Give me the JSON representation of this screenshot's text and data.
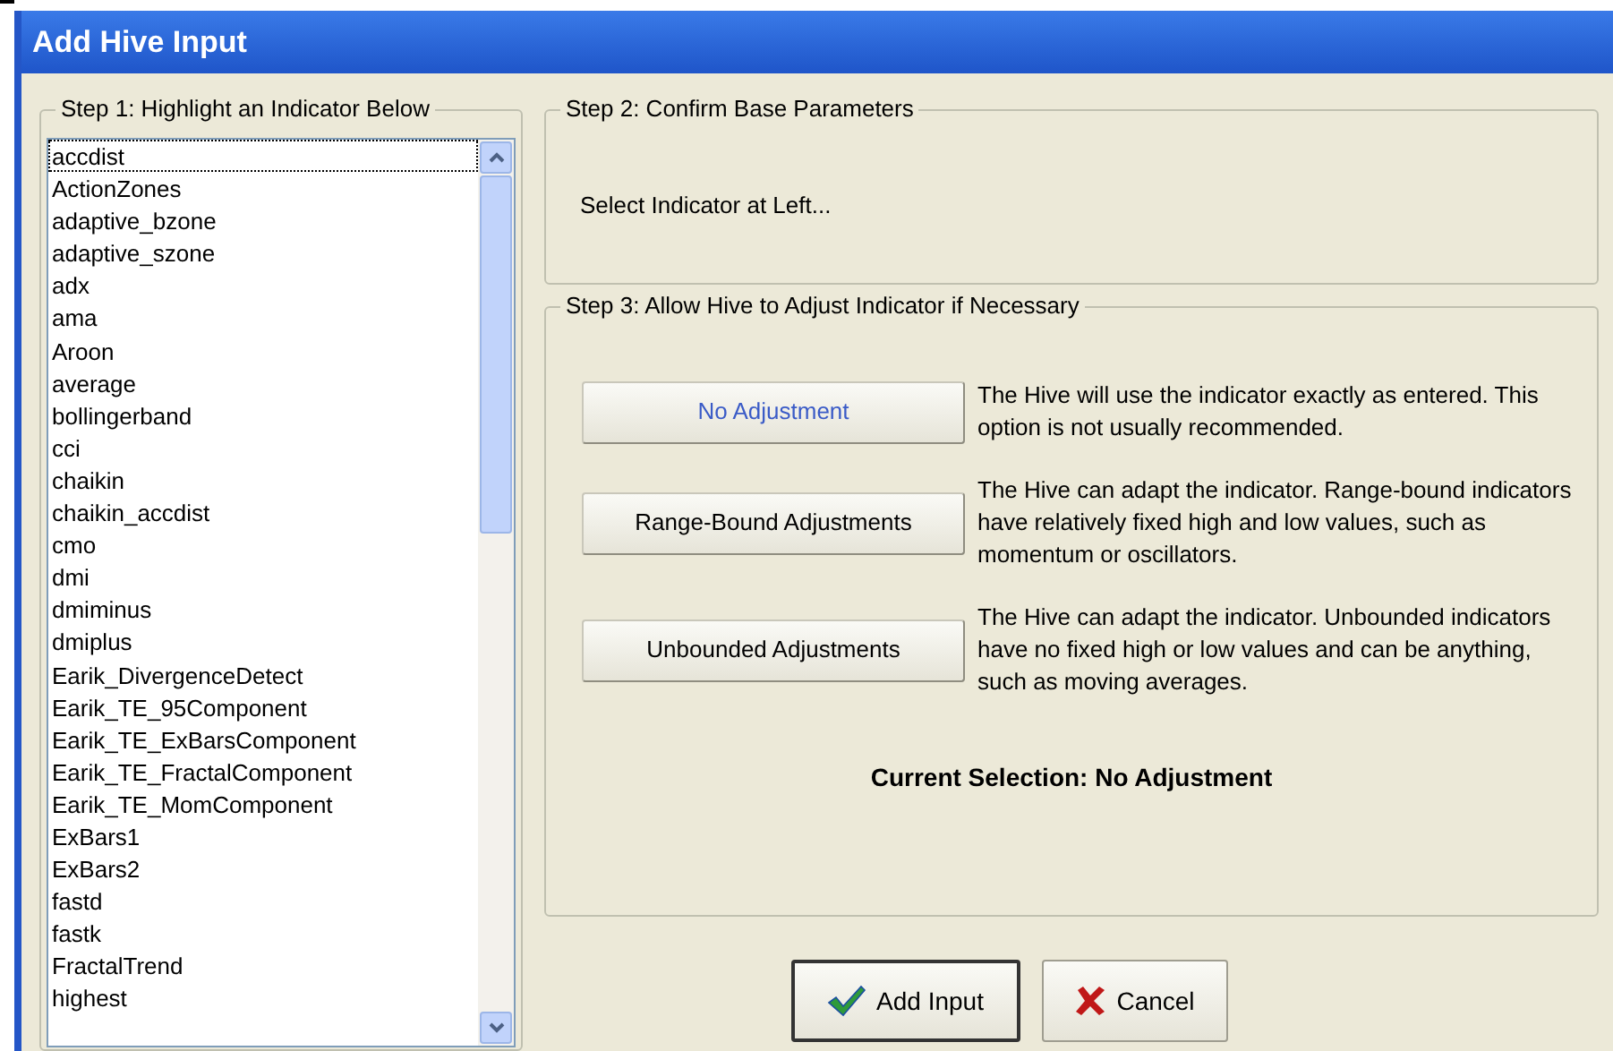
{
  "window": {
    "title": "Add Hive Input"
  },
  "step1": {
    "label": "Step 1: Highlight an Indicator Below",
    "indicators": [
      {
        "name": "accdist",
        "focused": true
      },
      {
        "name": "ActionZones",
        "focused": false
      },
      {
        "name": "adaptive_bzone",
        "focused": false
      },
      {
        "name": "adaptive_szone",
        "focused": false
      },
      {
        "name": "adx",
        "focused": false
      },
      {
        "name": "ama",
        "focused": false
      },
      {
        "name": "Aroon",
        "focused": false
      },
      {
        "name": "average",
        "focused": false
      },
      {
        "name": "bollingerband",
        "focused": false
      },
      {
        "name": "cci",
        "focused": false
      },
      {
        "name": "chaikin",
        "focused": false
      },
      {
        "name": "chaikin_accdist",
        "focused": false
      },
      {
        "name": "cmo",
        "focused": false
      },
      {
        "name": "dmi",
        "focused": false
      },
      {
        "name": "dmiminus",
        "focused": false
      },
      {
        "name": "dmiplus",
        "focused": false
      },
      {
        "name": "Earik_DivergenceDetect",
        "focused": false
      },
      {
        "name": "Earik_TE_95Component",
        "focused": false
      },
      {
        "name": "Earik_TE_ExBarsComponent",
        "focused": false
      },
      {
        "name": "Earik_TE_FractalComponent",
        "focused": false
      },
      {
        "name": "Earik_TE_MomComponent",
        "focused": false
      },
      {
        "name": "ExBars1",
        "focused": false
      },
      {
        "name": "ExBars2",
        "focused": false
      },
      {
        "name": "fastd",
        "focused": false
      },
      {
        "name": "fastk",
        "focused": false
      },
      {
        "name": "FractalTrend",
        "focused": false
      },
      {
        "name": "highest",
        "focused": false
      }
    ]
  },
  "step2": {
    "label": "Step 2: Confirm Base Parameters",
    "message": "Select Indicator at Left..."
  },
  "step3": {
    "label": "Step 3: Allow Hive to Adjust Indicator if Necessary",
    "options": [
      {
        "button": "No Adjustment",
        "selected": true,
        "description": "The Hive will use the indicator exactly as entered. This option is not usually recommended."
      },
      {
        "button": "Range-Bound Adjustments",
        "selected": false,
        "description": "The Hive can adapt the indicator. Range-bound indicators have relatively fixed high and low values, such as momentum or oscillators."
      },
      {
        "button": "Unbounded Adjustments",
        "selected": false,
        "description": "The Hive can adapt the indicator. Unbounded indicators have no fixed high or low values and can be anything, such as moving averages."
      }
    ],
    "current_selection": "Current Selection: No Adjustment"
  },
  "buttons": [
    {
      "kind": "ok",
      "label": "Add Input"
    },
    {
      "kind": "cancel",
      "label": "Cancel"
    }
  ]
}
